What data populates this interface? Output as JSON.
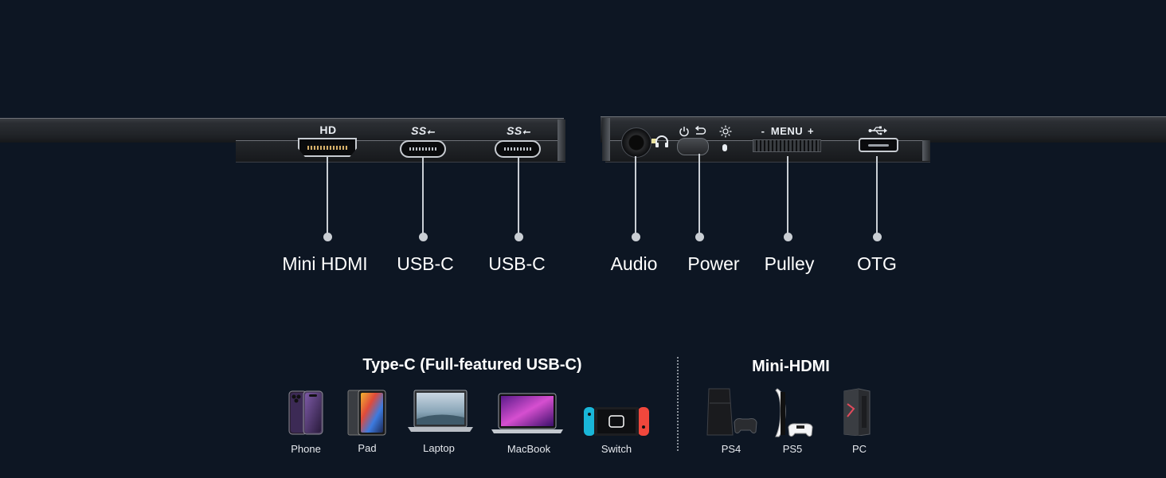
{
  "ports_top": {
    "hd_label": "HD",
    "ss_label_1": "SS",
    "ss_label_2": "SS",
    "menu_label": "MENU",
    "menu_minus": "-",
    "menu_plus": "+"
  },
  "port_names": {
    "mini_hdmi": "Mini HDMI",
    "usbc_1": "USB-C",
    "usbc_2": "USB-C",
    "audio": "Audio",
    "power": "Power",
    "pulley": "Pulley",
    "otg": "OTG"
  },
  "sections": {
    "typec_title": "Type-C (Full-featured USB-C)",
    "minihdmi_title": "Mini-HDMI"
  },
  "devices_typec": [
    {
      "label": "Phone",
      "icon": "phone-icon"
    },
    {
      "label": "Pad",
      "icon": "tablet-icon"
    },
    {
      "label": "Laptop",
      "icon": "laptop-icon"
    },
    {
      "label": "MacBook",
      "icon": "macbook-icon"
    },
    {
      "label": "Switch",
      "icon": "game-switch-icon"
    }
  ],
  "devices_hdmi": [
    {
      "label": "PS4",
      "icon": "ps4-console-icon"
    },
    {
      "label": "PS5",
      "icon": "ps5-console-icon"
    },
    {
      "label": "PC",
      "icon": "pc-tower-icon"
    }
  ],
  "colors": {
    "background": "#0d1623",
    "callout_line": "#c9ced4",
    "text": "#ffffff"
  }
}
